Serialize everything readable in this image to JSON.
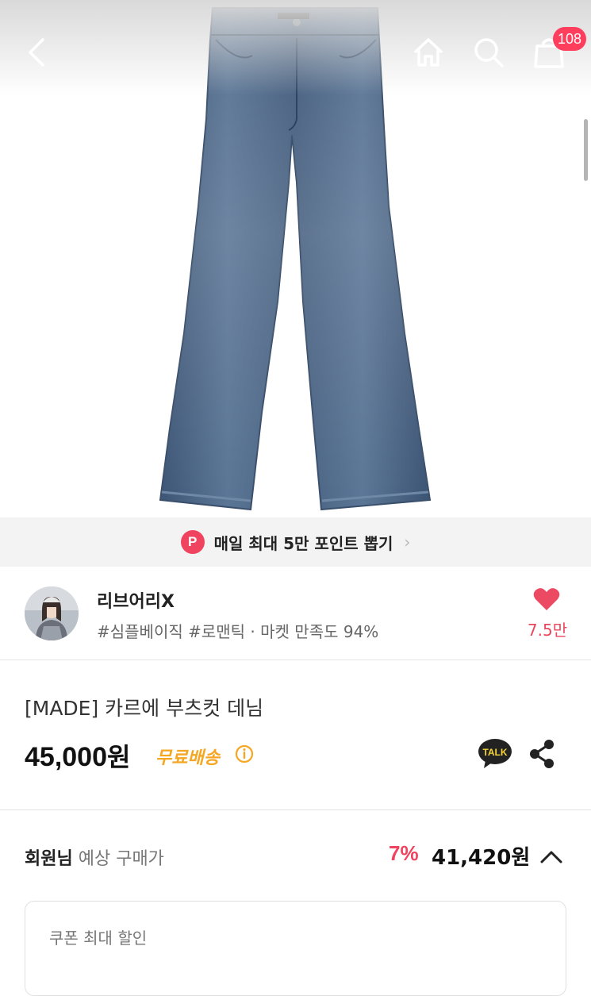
{
  "header": {
    "cart_count": "108",
    "icons": [
      "back-arrow-icon",
      "home-icon",
      "search-icon",
      "shopping-bag-icon"
    ]
  },
  "points_banner": {
    "badge": "P",
    "text": "매일 최대 5만 포인트 뽑기",
    "chevron": "›"
  },
  "shop": {
    "name": "리브어리X",
    "tags": "#심플베이직 #로맨틱 · 마켓 만족도 94%",
    "like_count": "7.5만"
  },
  "product": {
    "title": "[MADE] 카르에 부츠컷 데님",
    "price_number": "45,000",
    "price_unit": "원",
    "free_shipping": "무료배송",
    "talk_label": "TALK"
  },
  "member_price": {
    "label_strong": "회원님",
    "label_rest": " 예상 구매가",
    "discount": "7%",
    "price": "41,420원"
  },
  "coupon": {
    "label": "쿠폰 최대 할인"
  },
  "colors": {
    "accent_red": "#f0435f",
    "badge_red": "#ff3d5d",
    "like_pink": "#e8485d",
    "free_ship_orange": "#f5a623",
    "denim_blue": "#4d6686"
  }
}
